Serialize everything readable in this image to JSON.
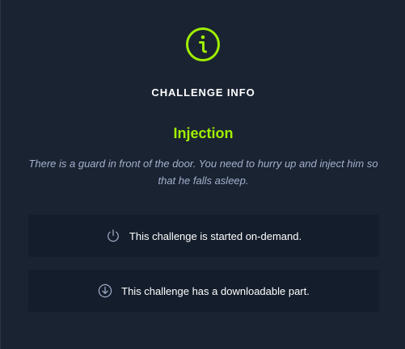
{
  "panel": {
    "heading": "CHALLENGE INFO",
    "challenge_name": "Injection",
    "description": "There is a guard in front of the door. You need to hurry up and inject him so that he falls asleep.",
    "icon": "info-circle-icon"
  },
  "features": [
    {
      "icon": "power-icon",
      "text": "This challenge is started on-demand."
    },
    {
      "icon": "download-circle-icon",
      "text": "This challenge has a downloadable part."
    }
  ],
  "colors": {
    "background": "#1a2332",
    "card_background": "#141d2b",
    "accent": "#9fef00",
    "description_text": "#a4b1cd",
    "icon_muted": "#a4b1cd"
  }
}
